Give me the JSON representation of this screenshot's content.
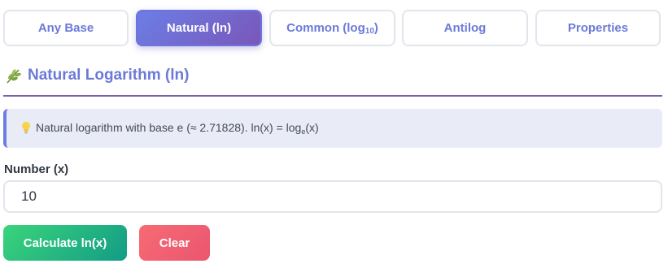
{
  "tabs": [
    {
      "label": "Any Base",
      "active": false
    },
    {
      "label": "Natural (ln)",
      "active": true
    },
    {
      "label_main": "Common (log",
      "label_sub": "10",
      "label_end": ")",
      "active": false
    },
    {
      "label": "Antilog",
      "active": false
    },
    {
      "label": "Properties",
      "active": false
    }
  ],
  "section": {
    "icon": "leaf-icon",
    "title": "Natural Logarithm (ln)"
  },
  "info": {
    "icon": "lightbulb-icon",
    "text_before": "Natural logarithm with base e (≈ 2.71828). ln(x) = log",
    "text_sub": "e",
    "text_after": "(x)"
  },
  "number_field": {
    "label": "Number (x)",
    "value": "10"
  },
  "buttons": {
    "calculate": "Calculate ln(x)",
    "clear": "Clear"
  },
  "colors": {
    "accent": "#6b7ad8",
    "active_tab_gradient": [
      "#6b7ee6",
      "#7a57b9"
    ],
    "calculate_gradient": [
      "#3ad47b",
      "#139c86"
    ],
    "clear_gradient": [
      "#f76b73",
      "#ea5670"
    ]
  }
}
